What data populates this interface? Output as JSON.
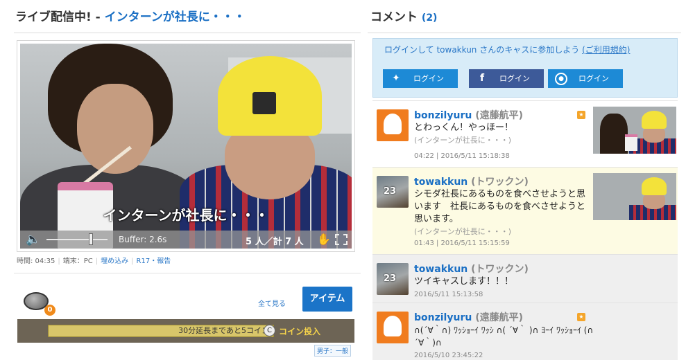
{
  "header": {
    "live_label": "ライブ配信中! - ",
    "cast_title": "インターンが社長に・・・"
  },
  "player": {
    "caption": "インターンが社長に・・・",
    "buffer": "Buffer: 2.6s",
    "viewers": "5 人／計 7 人",
    "volume_level": 0.8
  },
  "meta": {
    "time": "時間: 04:35",
    "device": "端末：PC",
    "embed": "埋め込み",
    "report": "R17・報告"
  },
  "items": {
    "coin_count": "0",
    "see_all": "全て見る",
    "item_button": "アイテム",
    "extend_text": "30分延長まであと5コイン",
    "coin_insert": "コイン投入",
    "gender_tag": "男子：一般"
  },
  "comments_panel": {
    "title": "コメント",
    "count": "(2)",
    "login_text": "ログインして towakkun さんのキャスに参加しよう",
    "terms_link": "(ご利用規約)",
    "login_twitter": "ログイン",
    "login_facebook": "ログイン",
    "login_twitcas": "ログイン"
  },
  "comments": [
    {
      "user": "bonzilyuru",
      "display": "(遠藤航平)",
      "text": "とわっくん！やっほー！",
      "sub": "(インターンが社長に・・・)",
      "time": "04:22 | 2016/5/11 15:18:38"
    },
    {
      "user": "towakkun",
      "display": "(トワックン)",
      "avatar_num": "23",
      "text": "シモダ社長にあるものを食べさせようと思います　社長にあるものを食べさせようと思います。",
      "sub": "(インターンが社長に・・・)",
      "time": "01:43 | 2016/5/11 15:15:59"
    },
    {
      "user": "towakkun",
      "display": "(トワックン)",
      "avatar_num": "23",
      "text": "ツイキャスします！！！",
      "time": "2016/5/11 15:13:58"
    },
    {
      "user": "bonzilyuru",
      "display": "(遠藤航平)",
      "text": "∩(´∀｀∩) ﾜｯｼｮｰｲ ﾜｯｼ ∩( ´∀｀ )∩ ﾖｰｲ ﾜｯｼｮｰｲ (∩´∀｀)∩",
      "time": "2016/5/10 23:45:22"
    }
  ],
  "colors": {
    "accent": "#1a6fc4",
    "item_button": "#1b74c8",
    "highlight_comment": "#fdfbe3",
    "twitter": "#1d8ad6",
    "facebook": "#3d5a99"
  }
}
